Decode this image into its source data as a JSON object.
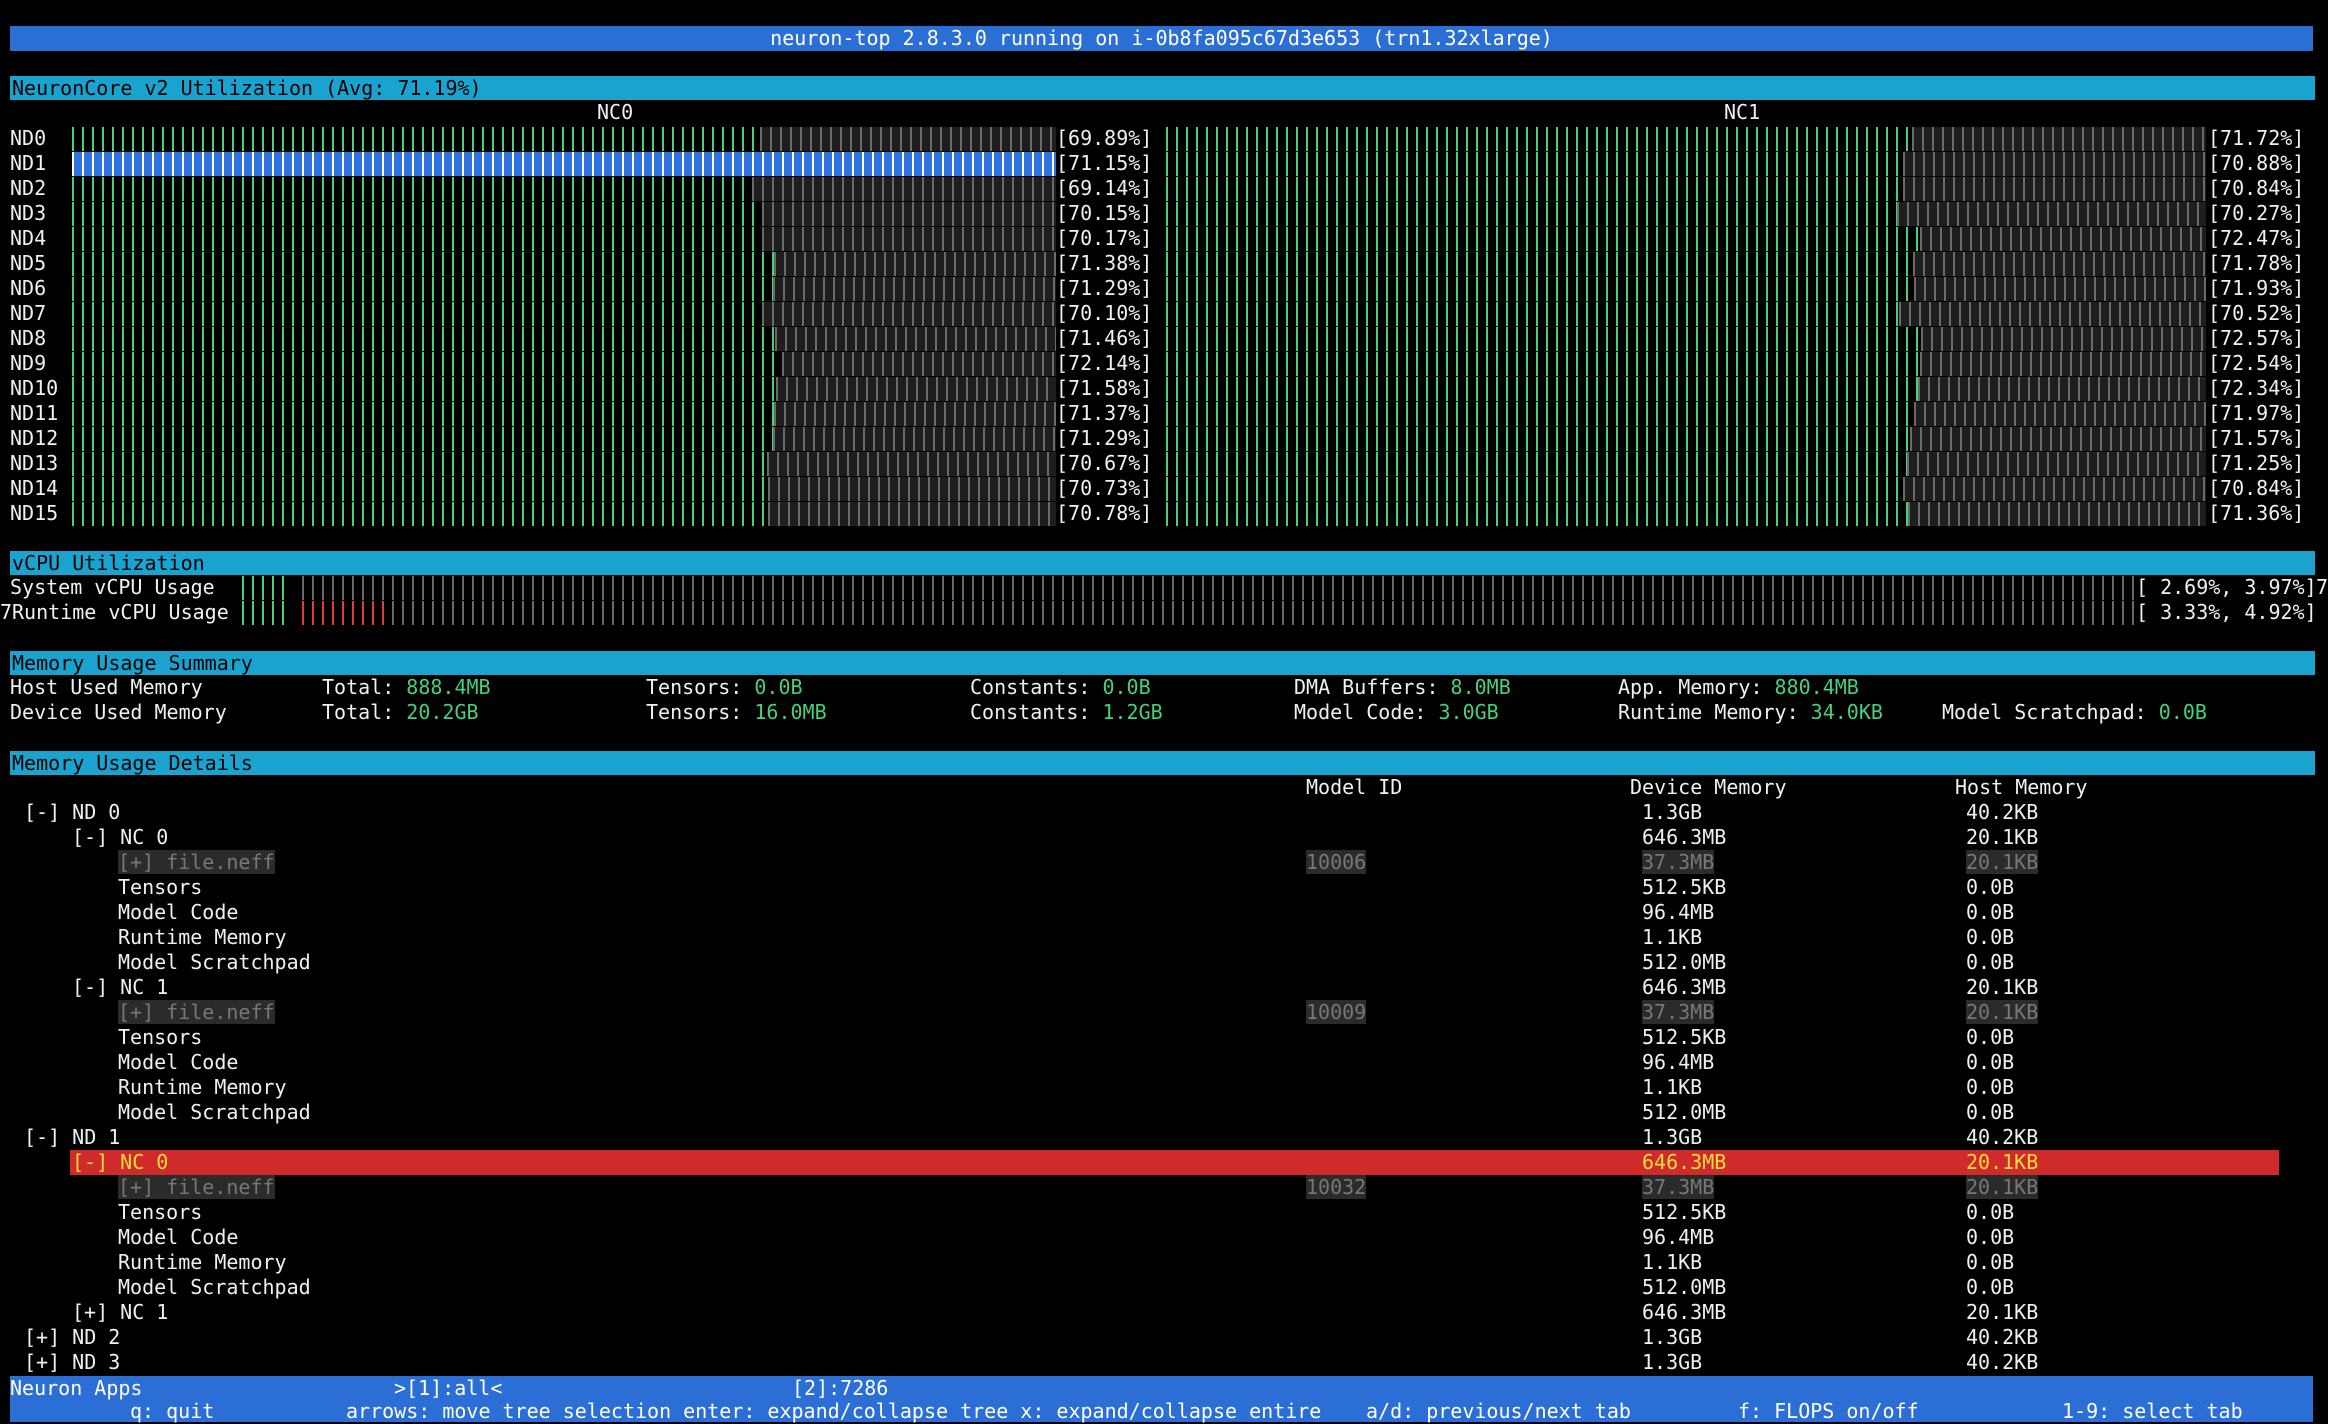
{
  "title": "neuron-top 2.8.3.0 running on i-0b8fa095c67d3e653 (trn1.32xlarge)",
  "neuroncore": {
    "header": "NeuronCore v2 Utilization (Avg: 71.19%)",
    "columns": [
      "NC0",
      "NC1"
    ],
    "rows": [
      {
        "device": "ND0",
        "nc0": "[69.89%]",
        "nc1": "[71.72%]",
        "nc0_value": 69.89,
        "nc1_value": 71.72
      },
      {
        "device": "ND1",
        "nc0": "[71.15%]",
        "nc1": "[70.88%]",
        "nc0_value": 71.15,
        "nc1_value": 70.88
      },
      {
        "device": "ND2",
        "nc0": "[69.14%]",
        "nc1": "[70.84%]",
        "nc0_value": 69.14,
        "nc1_value": 70.84
      },
      {
        "device": "ND3",
        "nc0": "[70.15%]",
        "nc1": "[70.27%]",
        "nc0_value": 70.15,
        "nc1_value": 70.27
      },
      {
        "device": "ND4",
        "nc0": "[70.17%]",
        "nc1": "[72.47%]",
        "nc0_value": 70.17,
        "nc1_value": 72.47
      },
      {
        "device": "ND5",
        "nc0": "[71.38%]",
        "nc1": "[71.78%]",
        "nc0_value": 71.38,
        "nc1_value": 71.78
      },
      {
        "device": "ND6",
        "nc0": "[71.29%]",
        "nc1": "[71.93%]",
        "nc0_value": 71.29,
        "nc1_value": 71.93
      },
      {
        "device": "ND7",
        "nc0": "[70.10%]",
        "nc1": "[70.52%]",
        "nc0_value": 70.1,
        "nc1_value": 70.52
      },
      {
        "device": "ND8",
        "nc0": "[71.46%]",
        "nc1": "[72.57%]",
        "nc0_value": 71.46,
        "nc1_value": 72.57
      },
      {
        "device": "ND9",
        "nc0": "[72.14%]",
        "nc1": "[72.54%]",
        "nc0_value": 72.14,
        "nc1_value": 72.54
      },
      {
        "device": "ND10",
        "nc0": "[71.58%]",
        "nc1": "[72.34%]",
        "nc0_value": 71.58,
        "nc1_value": 72.34
      },
      {
        "device": "ND11",
        "nc0": "[71.37%]",
        "nc1": "[71.97%]",
        "nc0_value": 71.37,
        "nc1_value": 71.97
      },
      {
        "device": "ND12",
        "nc0": "[71.29%]",
        "nc1": "[71.57%]",
        "nc0_value": 71.29,
        "nc1_value": 71.57
      },
      {
        "device": "ND13",
        "nc0": "[70.67%]",
        "nc1": "[71.25%]",
        "nc0_value": 70.67,
        "nc1_value": 71.25
      },
      {
        "device": "ND14",
        "nc0": "[70.73%]",
        "nc1": "[70.84%]",
        "nc0_value": 70.73,
        "nc1_value": 70.84
      },
      {
        "device": "ND15",
        "nc0": "[70.78%]",
        "nc1": "[71.36%]",
        "nc0_value": 70.78,
        "nc1_value": 71.36
      }
    ],
    "selected_device": "ND1"
  },
  "vcpu": {
    "header": "vCPU Utilization",
    "system_label": "System vCPU Usage",
    "system_value": "[ 2.69%, 3.97%]",
    "system_suffix": "7",
    "runtime_prefix": "7",
    "runtime_label": "Runtime vCPU Usage",
    "runtime_value": "[ 3.33%, 4.92%]"
  },
  "memory_summary": {
    "header": "Memory Usage Summary",
    "host": {
      "label": "Host Used Memory",
      "total_label": "Total:",
      "total": "888.4MB",
      "tensors_label": "Tensors:",
      "tensors": "0.0B",
      "constants_label": "Constants:",
      "constants": "0.0B",
      "dma_label": "DMA Buffers:",
      "dma": "8.0MB",
      "app_label": "App. Memory:",
      "app": "880.4MB"
    },
    "device": {
      "label": "Device Used Memory",
      "total_label": "Total:",
      "total": "20.2GB",
      "tensors_label": "Tensors:",
      "tensors": "16.0MB",
      "constants_label": "Constants:",
      "constants": "1.2GB",
      "code_label": "Model Code:",
      "code": "3.0GB",
      "runtime_label": "Runtime Memory:",
      "runtime": "34.0KB",
      "scratch_label": "Model Scratchpad:",
      "scratch": "0.0B"
    }
  },
  "memory_details": {
    "header": "Memory Usage Details",
    "col_model_id": "Model ID",
    "col_device": "Device Memory",
    "col_host": "Host Memory",
    "rows": [
      {
        "text": "[-] ND 0",
        "indent": 1,
        "model": "",
        "device": "1.3GB",
        "host": "40.2KB",
        "kind": "normal"
      },
      {
        "text": "[-] NC 0",
        "indent": 2,
        "model": "",
        "device": "646.3MB",
        "host": "20.1KB",
        "kind": "normal"
      },
      {
        "text": "[+] file.neff",
        "indent": 3,
        "model": "10006",
        "device": "37.3MB",
        "host": "20.1KB",
        "kind": "dim"
      },
      {
        "text": "Tensors",
        "indent": 3,
        "model": "",
        "device": "512.5KB",
        "host": "0.0B",
        "kind": "normal"
      },
      {
        "text": "Model Code",
        "indent": 3,
        "model": "",
        "device": "96.4MB",
        "host": "0.0B",
        "kind": "normal"
      },
      {
        "text": "Runtime Memory",
        "indent": 3,
        "model": "",
        "device": "1.1KB",
        "host": "0.0B",
        "kind": "normal"
      },
      {
        "text": "Model Scratchpad",
        "indent": 3,
        "model": "",
        "device": "512.0MB",
        "host": "0.0B",
        "kind": "normal"
      },
      {
        "text": "[-] NC 1",
        "indent": 2,
        "model": "",
        "device": "646.3MB",
        "host": "20.1KB",
        "kind": "normal"
      },
      {
        "text": "[+] file.neff",
        "indent": 3,
        "model": "10009",
        "device": "37.3MB",
        "host": "20.1KB",
        "kind": "dim"
      },
      {
        "text": "Tensors",
        "indent": 3,
        "model": "",
        "device": "512.5KB",
        "host": "0.0B",
        "kind": "normal"
      },
      {
        "text": "Model Code",
        "indent": 3,
        "model": "",
        "device": "96.4MB",
        "host": "0.0B",
        "kind": "normal"
      },
      {
        "text": "Runtime Memory",
        "indent": 3,
        "model": "",
        "device": "1.1KB",
        "host": "0.0B",
        "kind": "normal"
      },
      {
        "text": "Model Scratchpad",
        "indent": 3,
        "model": "",
        "device": "512.0MB",
        "host": "0.0B",
        "kind": "normal"
      },
      {
        "text": "[-] ND 1",
        "indent": 1,
        "model": "",
        "device": "1.3GB",
        "host": "40.2KB",
        "kind": "normal"
      },
      {
        "text": "[-] NC 0",
        "indent": 2,
        "model": "",
        "device": "646.3MB",
        "host": "20.1KB",
        "kind": "selected"
      },
      {
        "text": "[+] file.neff",
        "indent": 3,
        "model": "10032",
        "device": "37.3MB",
        "host": "20.1KB",
        "kind": "dim"
      },
      {
        "text": "Tensors",
        "indent": 3,
        "model": "",
        "device": "512.5KB",
        "host": "0.0B",
        "kind": "normal"
      },
      {
        "text": "Model Code",
        "indent": 3,
        "model": "",
        "device": "96.4MB",
        "host": "0.0B",
        "kind": "normal"
      },
      {
        "text": "Runtime Memory",
        "indent": 3,
        "model": "",
        "device": "1.1KB",
        "host": "0.0B",
        "kind": "normal"
      },
      {
        "text": "Model Scratchpad",
        "indent": 3,
        "model": "",
        "device": "512.0MB",
        "host": "0.0B",
        "kind": "normal"
      },
      {
        "text": "[+] NC 1",
        "indent": 2,
        "model": "",
        "device": "646.3MB",
        "host": "20.1KB",
        "kind": "normal"
      },
      {
        "text": "[+] ND 2",
        "indent": 1,
        "model": "",
        "device": "1.3GB",
        "host": "40.2KB",
        "kind": "normal"
      },
      {
        "text": "[+] ND 3",
        "indent": 1,
        "model": "",
        "device": "1.3GB",
        "host": "40.2KB",
        "kind": "normal"
      }
    ]
  },
  "footer": {
    "app_label": "Neuron Apps",
    "tab_all": ">[1]:all<",
    "tab_pid": "[2]:7286",
    "help_quit": "q: quit",
    "help_arrows": "arrows: move tree selection enter: expand/collapse tree x: expand/collapse entire",
    "help_ad": "a/d: previous/next tab",
    "help_flops": "f: FLOPS on/off",
    "help_select": "1-9: select tab"
  },
  "colors": {
    "title_bg": "#2a6ed6",
    "section_bg": "#1ba3cf",
    "value_green": "#44d17a",
    "selected_row": "#cf2b2b",
    "selected_text": "#f7dc3c"
  }
}
